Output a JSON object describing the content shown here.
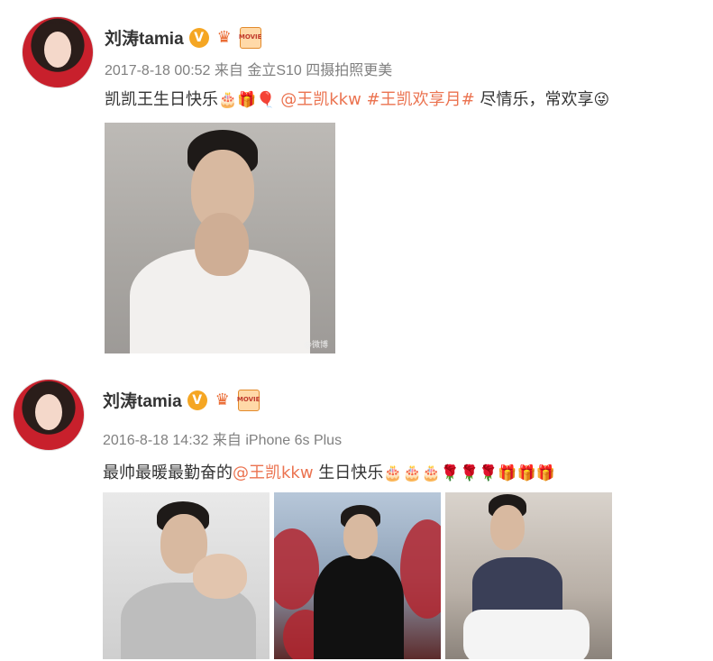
{
  "posts": [
    {
      "author": "刘涛tamia",
      "timestamp": "2017-8-18 00:52",
      "source": "来自 金立S10 四摄拍照更美",
      "text_before": "凯凯王生日快乐",
      "emojis_a": "🎂🎁🎈",
      "mention": "@王凯kkw",
      "hashtag": "#王凯欢享月#",
      "text_after": "尽情乐，常欢享",
      "emoji_end": "😜",
      "image_watermark": "@微博"
    },
    {
      "author": "刘涛tamia",
      "timestamp": "2016-8-18 14:32",
      "source": "来自 iPhone 6s Plus",
      "text_before": "最帅最暖最勤奋的",
      "mention": "@王凯kkw",
      "text_after": " 生日快乐",
      "emojis": "🎂🎂🎂🌹🌹🌹🎁🎁🎁"
    }
  ],
  "badges": {
    "v": "V",
    "crown": "♛",
    "movie": "MOVIE"
  },
  "colors": {
    "link": "#eb7350",
    "meta": "#808080",
    "verified": "#f5a623"
  }
}
